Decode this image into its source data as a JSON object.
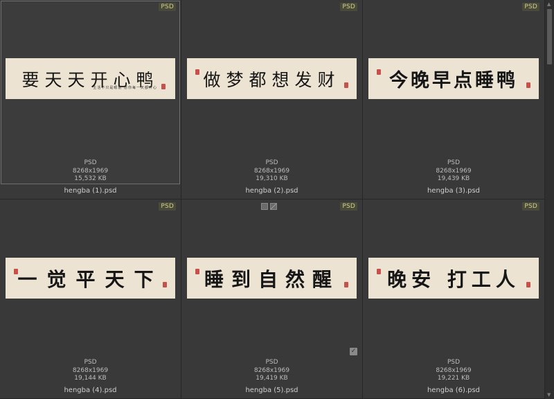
{
  "files": [
    {
      "badge": "PSD",
      "banner_text": "要天天开心鸭",
      "banner_subtext": "生活不只是眼前 愿你每一天都开心",
      "type": "PSD",
      "dimensions": "8268x1969",
      "size": "15,532 KB",
      "filename": "hengba (1).psd"
    },
    {
      "badge": "PSD",
      "banner_text": "做梦都想发财",
      "type": "PSD",
      "dimensions": "8268x1969",
      "size": "19,310 KB",
      "filename": "hengba (2).psd"
    },
    {
      "badge": "PSD",
      "banner_text": "今晚早点睡鸭",
      "type": "PSD",
      "dimensions": "8268x1969",
      "size": "19,439 KB",
      "filename": "hengba (3).psd"
    },
    {
      "badge": "PSD",
      "banner_text": "一觉平天下",
      "type": "PSD",
      "dimensions": "8268x1969",
      "size": "19,144 KB",
      "filename": "hengba (4).psd"
    },
    {
      "badge": "PSD",
      "banner_text": "睡到自然醒",
      "type": "PSD",
      "dimensions": "8268x1969",
      "size": "19,419 KB",
      "filename": "hengba (5).psd"
    },
    {
      "badge": "PSD",
      "banner_text": "晚安 打工人",
      "type": "PSD",
      "dimensions": "8268x1969",
      "size": "19,221 KB",
      "filename": "hengba (6).psd"
    }
  ],
  "checkbox_glyph": "✓",
  "colors": {
    "background": "#393939",
    "banner": "#ede3d3",
    "seal": "#c8504a",
    "badge_text": "#d0d08a"
  }
}
